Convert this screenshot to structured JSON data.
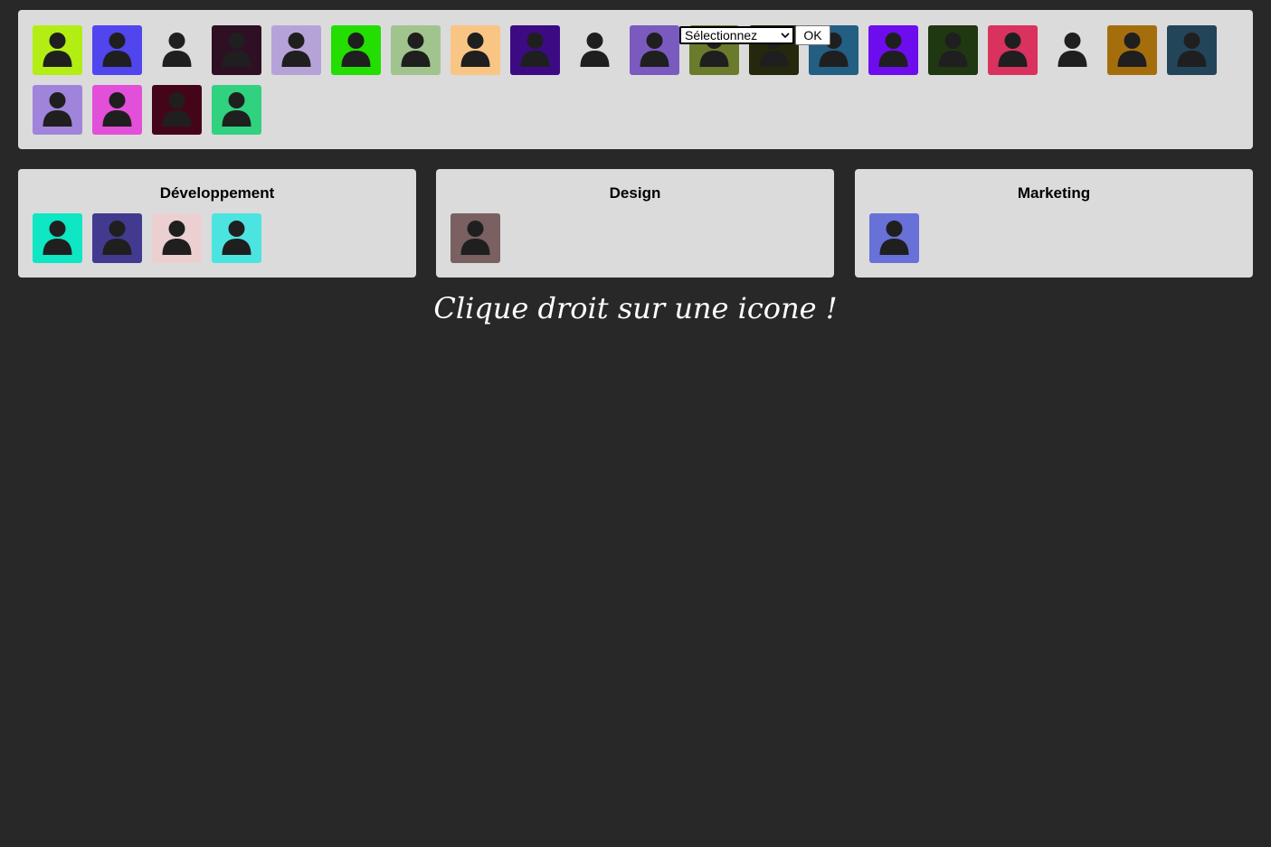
{
  "pool": {
    "avatars": [
      {
        "color": "#b2ee13",
        "person": "#1f1f1f"
      },
      {
        "color": "#5145ee",
        "person": "#1f1f1f"
      },
      {
        "color": "transparent",
        "person": "#1f1f1f"
      },
      {
        "color": "#2f0f24",
        "person": "#1f1f1f"
      },
      {
        "color": "#b5a3d8",
        "person": "#1f1f1f"
      },
      {
        "color": "#23de00",
        "person": "#1f1f1f"
      },
      {
        "color": "#a1c48f",
        "person": "#1f1f1f"
      },
      {
        "color": "#f9c584",
        "person": "#1f1f1f"
      },
      {
        "color": "#3c0b84",
        "person": "#1f1f1f"
      },
      {
        "color": "transparent",
        "person": "#1f1f1f"
      },
      {
        "color": "#7b5ac0",
        "person": "#1f1f1f"
      },
      {
        "color": "#6a7c2c",
        "person": "#1f1f1f"
      },
      {
        "color": "#26280d",
        "person": "#1f1f1f"
      },
      {
        "color": "#235e83",
        "person": "#1f1f1f"
      },
      {
        "color": "#6d0ded",
        "person": "#1f1f1f"
      },
      {
        "color": "#203812",
        "person": "#1f1f1f"
      },
      {
        "color": "#d9325e",
        "person": "#1f1f1f"
      },
      {
        "color": "transparent",
        "person": "#1f1f1f"
      },
      {
        "color": "#a56e0d",
        "person": "#1f1f1f"
      },
      {
        "color": "#23455a",
        "person": "#1f1f1f"
      },
      {
        "color": "#a084db",
        "person": "#1f1f1f"
      },
      {
        "color": "#e24fd8",
        "person": "#1f1f1f"
      },
      {
        "color": "#450518",
        "person": "#1f1f1f"
      },
      {
        "color": "#30d17f",
        "person": "#1f1f1f"
      }
    ]
  },
  "context_menu": {
    "select_value": "Sélectionnez",
    "ok_label": "OK"
  },
  "groups": [
    {
      "title": "Développement",
      "avatars": [
        {
          "color": "#0ee6c4",
          "person": "#1f1f1f"
        },
        {
          "color": "#423a8f",
          "person": "#1f1f1f"
        },
        {
          "color": "#ecd0d1",
          "person": "#1f1f1f"
        },
        {
          "color": "#4ce4e1",
          "person": "#1f1f1f"
        }
      ]
    },
    {
      "title": "Design",
      "avatars": [
        {
          "color": "#7a6060",
          "person": "#1f1f1f"
        }
      ]
    },
    {
      "title": "Marketing",
      "avatars": [
        {
          "color": "#6771d8",
          "person": "#1f1f1f"
        }
      ]
    }
  ],
  "hint": "Clique droit sur une icone !"
}
